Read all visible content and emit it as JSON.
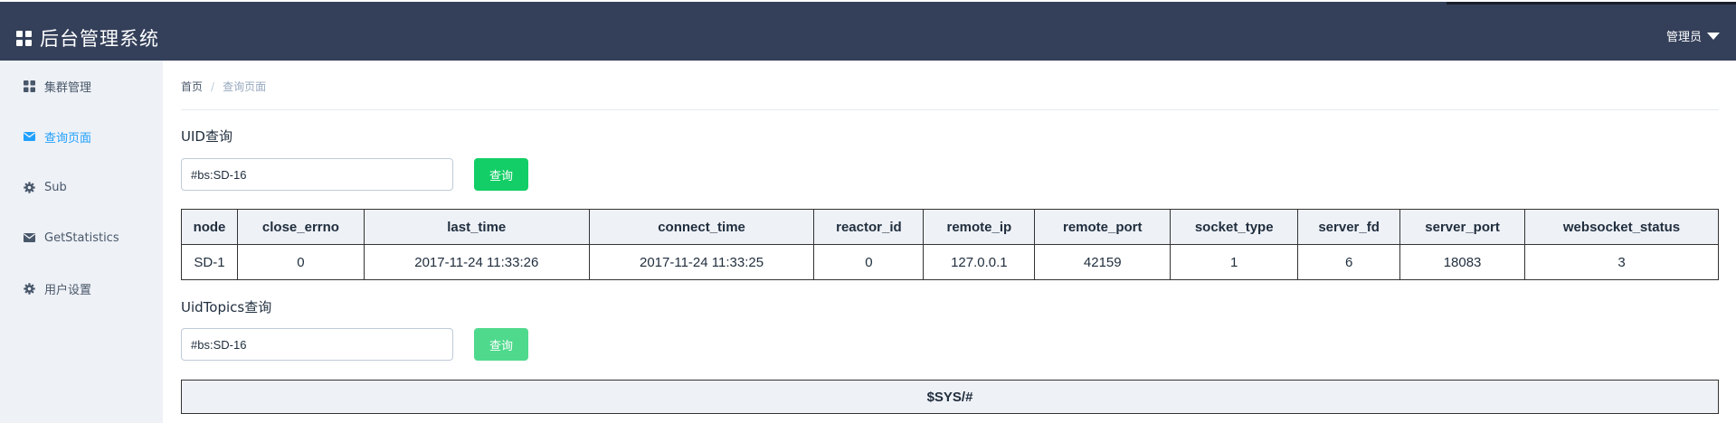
{
  "header": {
    "title": "后台管理系统",
    "user_label": "管理员"
  },
  "sidebar": {
    "items": [
      {
        "label": "集群管理",
        "icon": "grid-icon",
        "active": false
      },
      {
        "label": "查询页面",
        "icon": "envelope-icon",
        "active": true
      },
      {
        "label": "Sub",
        "icon": "gear-icon",
        "active": false
      },
      {
        "label": "GetStatistics",
        "icon": "envelope-icon",
        "active": false
      },
      {
        "label": "用户设置",
        "icon": "gear-icon",
        "active": false
      }
    ]
  },
  "breadcrumb": {
    "home": "首页",
    "separator": "/",
    "current": "查询页面"
  },
  "uid_query": {
    "title": "UID查询",
    "input_value": "#bs:SD-16",
    "button_label": "查询",
    "columns": [
      "node",
      "close_errno",
      "last_time",
      "connect_time",
      "reactor_id",
      "remote_ip",
      "remote_port",
      "socket_type",
      "server_fd",
      "server_port",
      "websocket_status"
    ],
    "rows": [
      [
        "SD-1",
        "0",
        "2017-11-24 11:33:26",
        "2017-11-24 11:33:25",
        "0",
        "127.0.0.1",
        "42159",
        "1",
        "6",
        "18083",
        "3"
      ]
    ]
  },
  "uid_topics_query": {
    "title": "UidTopics查询",
    "input_value": "#bs:SD-16",
    "button_label": "查询",
    "result": "$SYS/#"
  },
  "colors": {
    "header_bg": "#34405a",
    "sidebar_bg": "#eef1f6",
    "active_link": "#20a0ff",
    "button_green": "#13ce66",
    "button_green_light": "#4fd98d"
  }
}
